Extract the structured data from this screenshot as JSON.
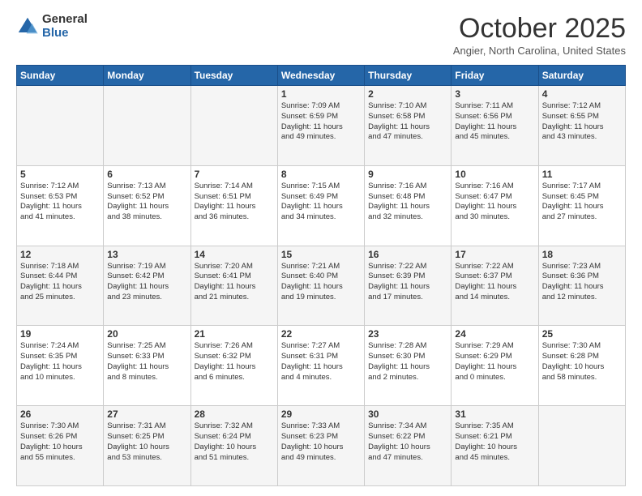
{
  "logo": {
    "general": "General",
    "blue": "Blue"
  },
  "header": {
    "month": "October 2025",
    "location": "Angier, North Carolina, United States"
  },
  "days_of_week": [
    "Sunday",
    "Monday",
    "Tuesday",
    "Wednesday",
    "Thursday",
    "Friday",
    "Saturday"
  ],
  "weeks": [
    [
      {
        "day": "",
        "info": ""
      },
      {
        "day": "",
        "info": ""
      },
      {
        "day": "",
        "info": ""
      },
      {
        "day": "1",
        "info": "Sunrise: 7:09 AM\nSunset: 6:59 PM\nDaylight: 11 hours\nand 49 minutes."
      },
      {
        "day": "2",
        "info": "Sunrise: 7:10 AM\nSunset: 6:58 PM\nDaylight: 11 hours\nand 47 minutes."
      },
      {
        "day": "3",
        "info": "Sunrise: 7:11 AM\nSunset: 6:56 PM\nDaylight: 11 hours\nand 45 minutes."
      },
      {
        "day": "4",
        "info": "Sunrise: 7:12 AM\nSunset: 6:55 PM\nDaylight: 11 hours\nand 43 minutes."
      }
    ],
    [
      {
        "day": "5",
        "info": "Sunrise: 7:12 AM\nSunset: 6:53 PM\nDaylight: 11 hours\nand 41 minutes."
      },
      {
        "day": "6",
        "info": "Sunrise: 7:13 AM\nSunset: 6:52 PM\nDaylight: 11 hours\nand 38 minutes."
      },
      {
        "day": "7",
        "info": "Sunrise: 7:14 AM\nSunset: 6:51 PM\nDaylight: 11 hours\nand 36 minutes."
      },
      {
        "day": "8",
        "info": "Sunrise: 7:15 AM\nSunset: 6:49 PM\nDaylight: 11 hours\nand 34 minutes."
      },
      {
        "day": "9",
        "info": "Sunrise: 7:16 AM\nSunset: 6:48 PM\nDaylight: 11 hours\nand 32 minutes."
      },
      {
        "day": "10",
        "info": "Sunrise: 7:16 AM\nSunset: 6:47 PM\nDaylight: 11 hours\nand 30 minutes."
      },
      {
        "day": "11",
        "info": "Sunrise: 7:17 AM\nSunset: 6:45 PM\nDaylight: 11 hours\nand 27 minutes."
      }
    ],
    [
      {
        "day": "12",
        "info": "Sunrise: 7:18 AM\nSunset: 6:44 PM\nDaylight: 11 hours\nand 25 minutes."
      },
      {
        "day": "13",
        "info": "Sunrise: 7:19 AM\nSunset: 6:42 PM\nDaylight: 11 hours\nand 23 minutes."
      },
      {
        "day": "14",
        "info": "Sunrise: 7:20 AM\nSunset: 6:41 PM\nDaylight: 11 hours\nand 21 minutes."
      },
      {
        "day": "15",
        "info": "Sunrise: 7:21 AM\nSunset: 6:40 PM\nDaylight: 11 hours\nand 19 minutes."
      },
      {
        "day": "16",
        "info": "Sunrise: 7:22 AM\nSunset: 6:39 PM\nDaylight: 11 hours\nand 17 minutes."
      },
      {
        "day": "17",
        "info": "Sunrise: 7:22 AM\nSunset: 6:37 PM\nDaylight: 11 hours\nand 14 minutes."
      },
      {
        "day": "18",
        "info": "Sunrise: 7:23 AM\nSunset: 6:36 PM\nDaylight: 11 hours\nand 12 minutes."
      }
    ],
    [
      {
        "day": "19",
        "info": "Sunrise: 7:24 AM\nSunset: 6:35 PM\nDaylight: 11 hours\nand 10 minutes."
      },
      {
        "day": "20",
        "info": "Sunrise: 7:25 AM\nSunset: 6:33 PM\nDaylight: 11 hours\nand 8 minutes."
      },
      {
        "day": "21",
        "info": "Sunrise: 7:26 AM\nSunset: 6:32 PM\nDaylight: 11 hours\nand 6 minutes."
      },
      {
        "day": "22",
        "info": "Sunrise: 7:27 AM\nSunset: 6:31 PM\nDaylight: 11 hours\nand 4 minutes."
      },
      {
        "day": "23",
        "info": "Sunrise: 7:28 AM\nSunset: 6:30 PM\nDaylight: 11 hours\nand 2 minutes."
      },
      {
        "day": "24",
        "info": "Sunrise: 7:29 AM\nSunset: 6:29 PM\nDaylight: 11 hours\nand 0 minutes."
      },
      {
        "day": "25",
        "info": "Sunrise: 7:30 AM\nSunset: 6:28 PM\nDaylight: 10 hours\nand 58 minutes."
      }
    ],
    [
      {
        "day": "26",
        "info": "Sunrise: 7:30 AM\nSunset: 6:26 PM\nDaylight: 10 hours\nand 55 minutes."
      },
      {
        "day": "27",
        "info": "Sunrise: 7:31 AM\nSunset: 6:25 PM\nDaylight: 10 hours\nand 53 minutes."
      },
      {
        "day": "28",
        "info": "Sunrise: 7:32 AM\nSunset: 6:24 PM\nDaylight: 10 hours\nand 51 minutes."
      },
      {
        "day": "29",
        "info": "Sunrise: 7:33 AM\nSunset: 6:23 PM\nDaylight: 10 hours\nand 49 minutes."
      },
      {
        "day": "30",
        "info": "Sunrise: 7:34 AM\nSunset: 6:22 PM\nDaylight: 10 hours\nand 47 minutes."
      },
      {
        "day": "31",
        "info": "Sunrise: 7:35 AM\nSunset: 6:21 PM\nDaylight: 10 hours\nand 45 minutes."
      },
      {
        "day": "",
        "info": ""
      }
    ]
  ]
}
